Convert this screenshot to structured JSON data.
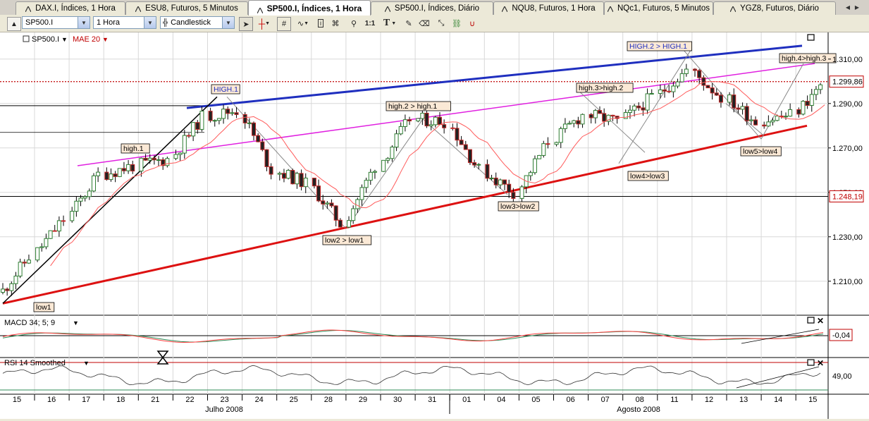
{
  "tabs": [
    {
      "label": "DAX.I, Índices, 1 Hora",
      "active": false
    },
    {
      "label": "ESU8, Futuros, 5 Minutos",
      "active": false
    },
    {
      "label": "SP500.I, Índices, 1 Hora",
      "active": true
    },
    {
      "label": "SP500.I, Índices, Diário",
      "active": false
    },
    {
      "label": "NQU8, Futuros, 1 Hora",
      "active": false
    },
    {
      "label": "NQc1, Futuros, 5 Minutos",
      "active": false
    },
    {
      "label": "YGZ8, Futuros, Diário",
      "active": false
    }
  ],
  "toolbar": {
    "symbol": "SP500.I",
    "interval": "1 Hora",
    "chart_type": "Candlestick",
    "tools": [
      "pointer-icon",
      "crosshair-icon",
      "grid-icon",
      "wave-icon",
      "info-icon",
      "magnet-icon",
      "zoom-icon",
      "one-to-one-icon",
      "text-icon",
      "pen-icon",
      "eraser-icon",
      "resize-icon",
      "link-icon",
      "horseshoe-icon"
    ],
    "one_to_one_label": "1:1",
    "text_label": "T"
  },
  "price_panel": {
    "symbol_label": "SP500.I",
    "indicator_label": "MAE 20",
    "last_price": "1.299,86",
    "marked_price": "1.248,19",
    "annotations": {
      "HIGH1": "HIGH.1",
      "HIGH2": "HIGH.2 > HIGH.1",
      "high1": "high.1",
      "high2": "high.2 > high.1",
      "high3": "high.3>high.2",
      "high4": "high.4>high.3",
      "low1": "low1",
      "low2": "low2 > low1",
      "low3": "low3>low2",
      "low4": "low4>low3",
      "low5": "low5>low4"
    }
  },
  "macd_panel": {
    "label": "MACD 34; 5; 9",
    "value": "-0,04"
  },
  "rsi_panel": {
    "label": "RSI 14 Smoothed",
    "value": "49,00"
  },
  "x_axis": {
    "days": [
      "15",
      "16",
      "17",
      "18",
      "21",
      "22",
      "23",
      "24",
      "25",
      "28",
      "29",
      "30",
      "31",
      "01",
      "04",
      "05",
      "06",
      "07",
      "08",
      "11",
      "12",
      "13",
      "14",
      "15"
    ],
    "months": [
      "Julho 2008",
      "Agosto 2008"
    ]
  },
  "chart_data": {
    "type": "candlestick",
    "ylim": [
      1195,
      1322
    ],
    "y_ticks": [
      1210,
      1230,
      1250,
      1270,
      1290,
      1310
    ],
    "y_tick_labels": [
      "1.210,00",
      "1.230,00",
      "1.250,00",
      "1.270,00",
      "1.290,00",
      "1.310,00"
    ],
    "last_price": 1299.86,
    "marked_price": 1248.19,
    "daily_close": [
      1221,
      1238,
      1258,
      1262,
      1265,
      1284,
      1287,
      1260,
      1254,
      1236,
      1262,
      1283,
      1282,
      1260,
      1250,
      1273,
      1285,
      1282,
      1293,
      1305,
      1293,
      1282,
      1285,
      1300
    ],
    "colors": {
      "up": "#2e7d32",
      "down": "#c62828",
      "ma": "#ff5a5a",
      "resistance": "#1f2fbf",
      "upper_channel": "#e020e0",
      "support": "#dd1111",
      "trend": "#000000"
    }
  }
}
